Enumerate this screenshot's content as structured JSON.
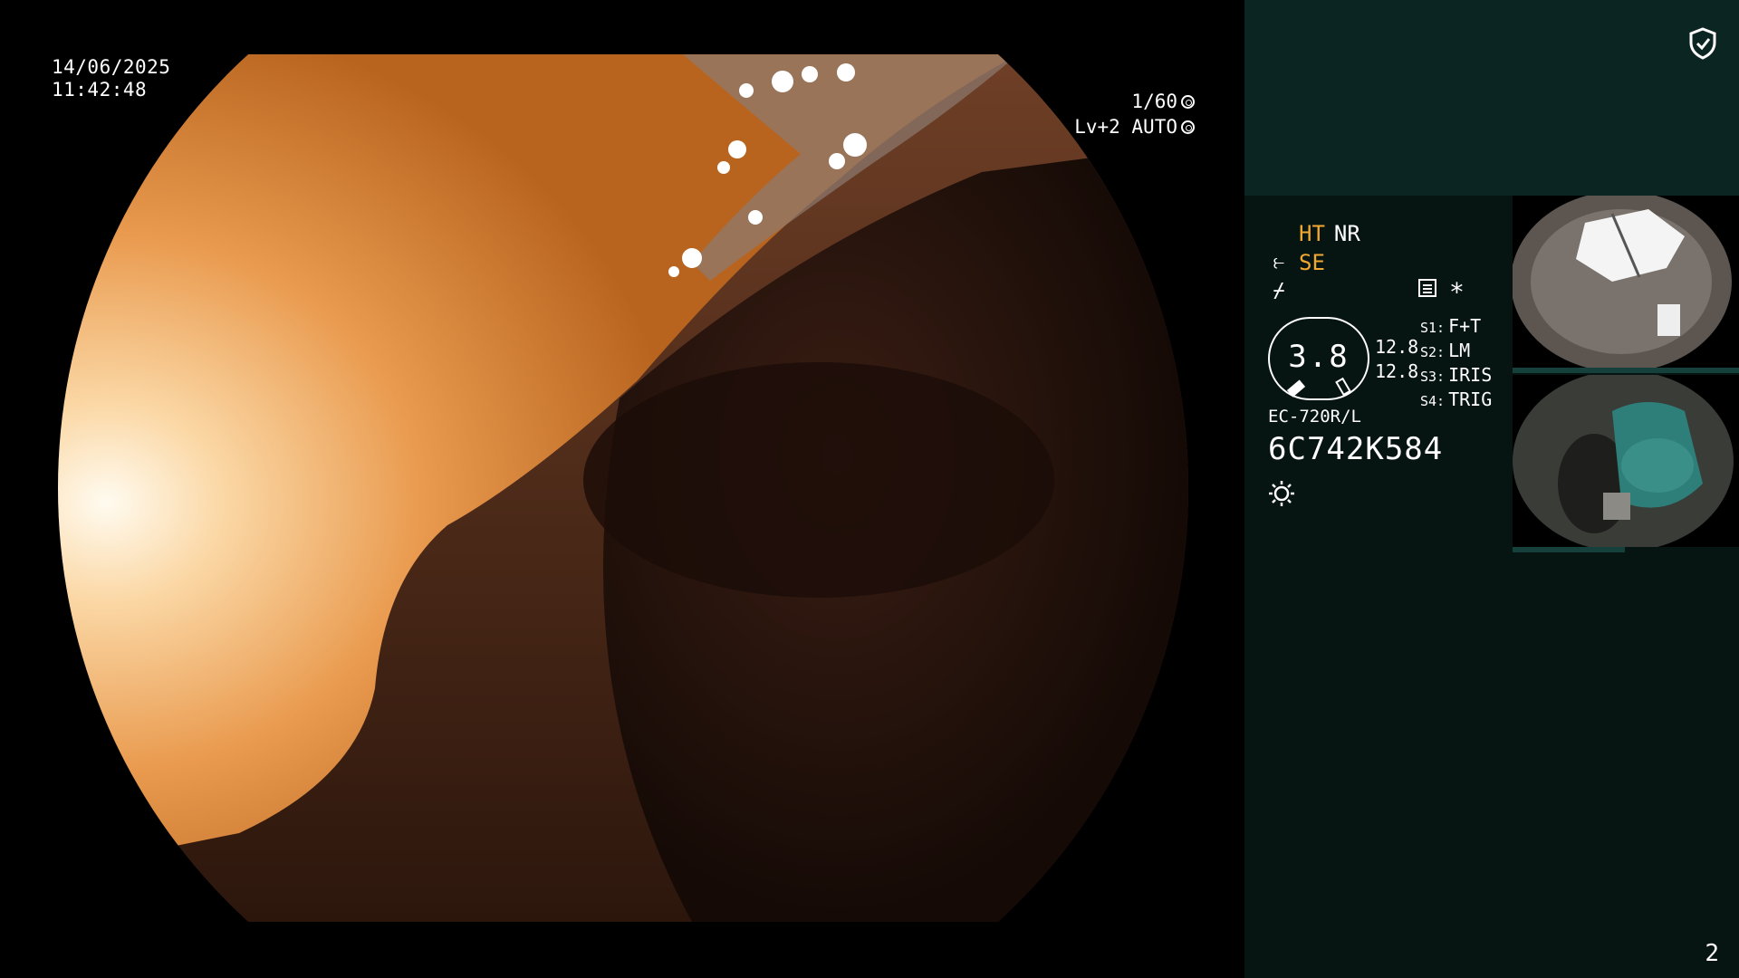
{
  "overlay": {
    "date": "14/06/2025",
    "time": "11:42:48",
    "shutter": "1/60",
    "exposure_level": "Lv+2 AUTO"
  },
  "side_panel": {
    "modes": {
      "ht": "HT",
      "nr": "NR",
      "se": "SE"
    },
    "zoom": {
      "value": "3.8",
      "readout_1": "12.8",
      "readout_2": "12.8"
    },
    "switches": [
      {
        "key": "S1:",
        "value": "F+T"
      },
      {
        "key": "S2:",
        "value": "LM"
      },
      {
        "key": "S3:",
        "value": "IRIS"
      },
      {
        "key": "S4:",
        "value": "TRIG"
      }
    ],
    "scope_model": "EC-720R/L",
    "scope_serial": "6C742K584",
    "asterisk": "*",
    "page_number": "2"
  },
  "colors": {
    "panel_bg": "#061412",
    "panel_top_bg": "#0b2523",
    "mode_active": "#f0a830",
    "mucosa_bright": "#f3a35a",
    "mucosa_dark": "#2a1710"
  },
  "icons": {
    "shield": "shield-check-icon",
    "shutter": "aperture-icon",
    "auto": "target-icon",
    "light_guide": "scope-icon",
    "freeze": "lightning-icon",
    "settings": "list-box-icon",
    "light": "sun-icon"
  }
}
